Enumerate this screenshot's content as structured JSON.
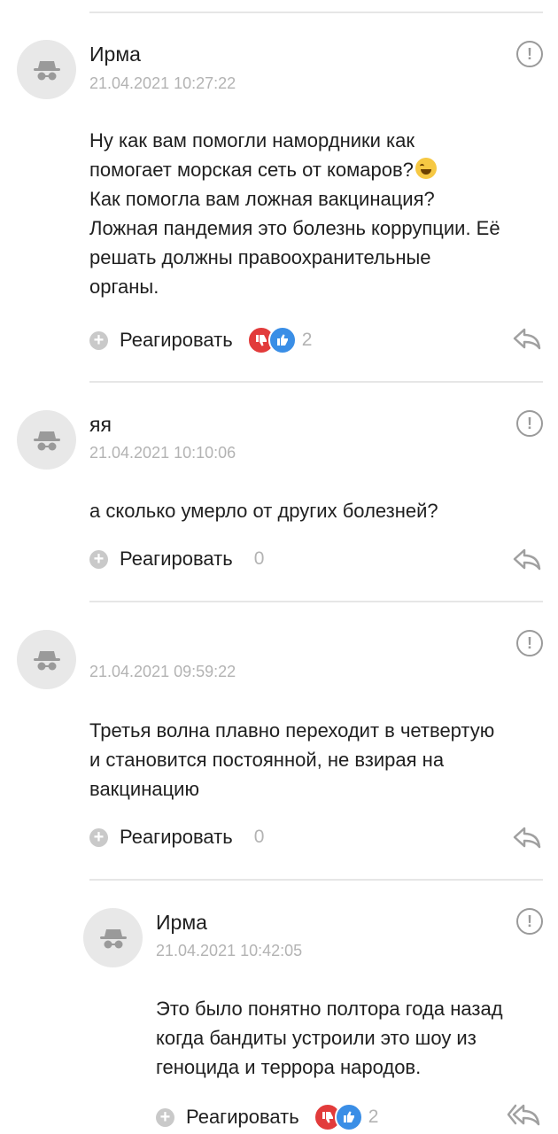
{
  "comments": [
    {
      "author": "Ирма",
      "time": "21.04.2021 10:27:22",
      "lines": [
        "Ну как вам помогли намордники как",
        "помогает морская сеть от комаров?",
        "Как помогла вам ложная вакцинация?",
        "Ложная пандемия это болезнь коррупции. Её",
        "решать должны правоохранительные",
        "органы."
      ],
      "emoji_icon": "grinning-sweat-emoji",
      "react_label": "Реагировать",
      "reaction_count": "2"
    },
    {
      "author": "яя",
      "time": "21.04.2021 10:10:06",
      "lines": [
        "а сколько умерло от других болезней?"
      ],
      "react_label": "Реагировать",
      "reaction_count": "0"
    },
    {
      "author": "",
      "time": "21.04.2021 09:59:22",
      "lines": [
        "Третья волна плавно переходит в четвертую",
        "и становится постоянной, не взирая на",
        "вакцинацию"
      ],
      "react_label": "Реагировать",
      "reaction_count": "0"
    },
    {
      "author": "Ирма",
      "time": "21.04.2021 10:42:05",
      "lines": [
        "Это было понятно полтора года назад",
        "когда бандиты устроили это шоу из",
        "геноцида и террора народов."
      ],
      "react_label": "Реагировать",
      "reaction_count": "2"
    }
  ],
  "colors": {
    "dislike": "#e23b3b",
    "like": "#3a8ee6",
    "muted": "#b3b3b3"
  }
}
